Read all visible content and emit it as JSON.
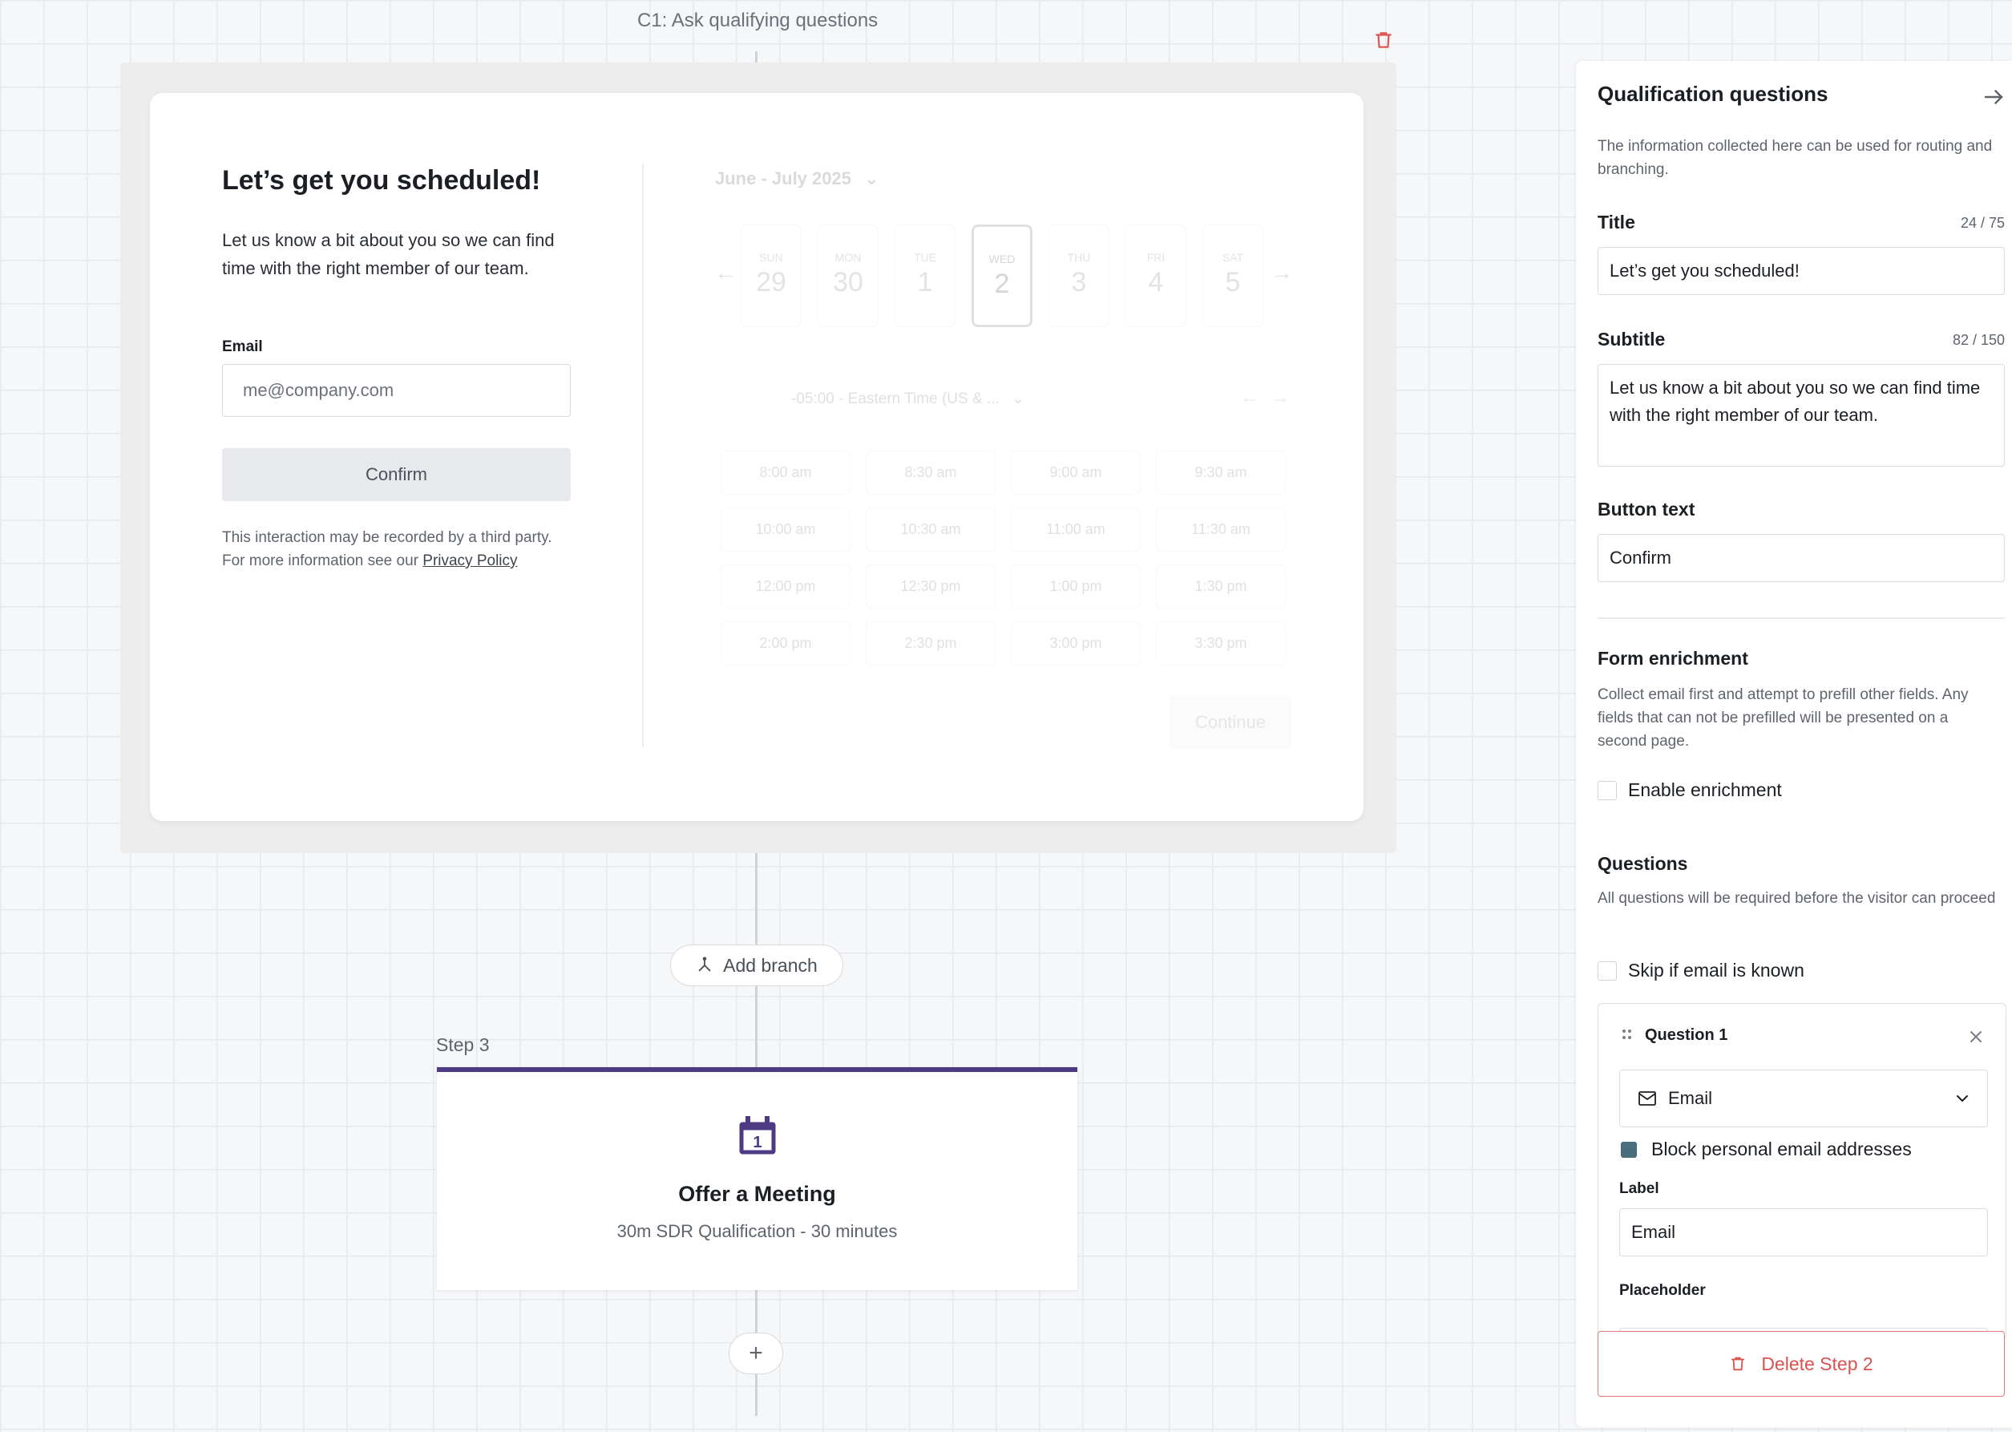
{
  "canvas": {
    "step_title": "C1: Ask qualifying questions",
    "add_branch_label": "Add branch",
    "add_step_label": "+"
  },
  "preview": {
    "title": "Let’s get you scheduled!",
    "subtitle": "Let us know a bit about you so we can find time with the right member of our team.",
    "email_label": "Email",
    "email_placeholder": "me@company.com",
    "confirm_label": "Confirm",
    "disclaimer_text": "This interaction may be recorded by a third party. For more information see our ",
    "privacy_link": "Privacy Policy",
    "calendar": {
      "month_label": "June - July 2025",
      "days": [
        {
          "name": "SUN",
          "num": "29"
        },
        {
          "name": "MON",
          "num": "30"
        },
        {
          "name": "TUE",
          "num": "1"
        },
        {
          "name": "WED",
          "num": "2",
          "selected": true
        },
        {
          "name": "THU",
          "num": "3"
        },
        {
          "name": "FRI",
          "num": "4"
        },
        {
          "name": "SAT",
          "num": "5"
        }
      ],
      "timezone": "-05:00 - Eastern Time (US & ...",
      "slots": [
        "8:00 am",
        "8:30 am",
        "9:00 am",
        "9:30 am",
        "10:00 am",
        "10:30 am",
        "11:00 am",
        "11:30 am",
        "12:00 pm",
        "12:30 pm",
        "1:00 pm",
        "1:30 pm",
        "2:00 pm",
        "2:30 pm",
        "3:00 pm",
        "3:30 pm"
      ],
      "continue_label": "Continue"
    }
  },
  "step3": {
    "label": "Step 3",
    "title": "Offer a Meeting",
    "subtitle": "30m SDR Qualification - 30 minutes",
    "accent_color": "#4c3a84"
  },
  "panel": {
    "title": "Qualification questions",
    "description": "The information collected here can be used for routing and branching.",
    "title_field": {
      "label": "Title",
      "count": "24 / 75",
      "value": "Let’s get you scheduled!"
    },
    "subtitle_field": {
      "label": "Subtitle",
      "count": "82 / 150",
      "value": "Let us know a bit about you so we can find time with the right member of our team."
    },
    "button_text_field": {
      "label": "Button text",
      "value": "Confirm"
    },
    "form_enrichment": {
      "heading": "Form enrichment",
      "description": "Collect email first and attempt to prefill other fields. Any fields that can not be prefilled will be presented on a second page.",
      "checkbox_label": "Enable enrichment"
    },
    "questions": {
      "heading": "Questions",
      "description": "All questions will be required before the visitor can proceed",
      "skip_label": "Skip if email is known",
      "question1": {
        "title": "Question 1",
        "type_value": "Email",
        "block_label": "Block personal email addresses",
        "label_label": "Label",
        "label_value": "Email",
        "placeholder_label": "Placeholder"
      }
    },
    "delete_label": "Delete Step 2",
    "danger_color": "#d9534f"
  }
}
